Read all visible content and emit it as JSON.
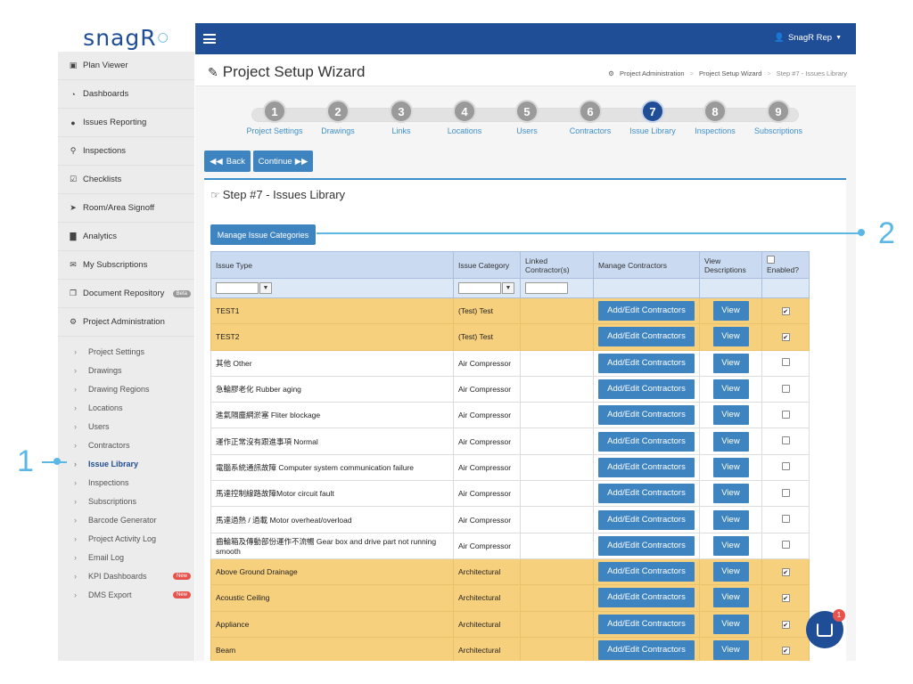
{
  "app": {
    "logo": "snagR"
  },
  "sidebar": {
    "items": [
      {
        "icon": "image-icon",
        "glyph": "▣",
        "label": "Plan Viewer"
      },
      {
        "icon": "dashboard-icon",
        "glyph": "◔",
        "label": "Dashboards"
      },
      {
        "icon": "map-pin-icon",
        "glyph": "●",
        "label": "Issues Reporting"
      },
      {
        "icon": "search-icon",
        "glyph": "⚲",
        "label": "Inspections"
      },
      {
        "icon": "checkbox-icon",
        "glyph": "☑",
        "label": "Checklists"
      },
      {
        "icon": "send-icon",
        "glyph": "➤",
        "label": "Room/Area Signoff"
      },
      {
        "icon": "bar-chart-icon",
        "glyph": "▇",
        "label": "Analytics"
      },
      {
        "icon": "envelope-icon",
        "glyph": "✉",
        "label": "My Subscriptions"
      },
      {
        "icon": "documents-icon",
        "glyph": "❐",
        "label": "Document Repository",
        "badge": "Beta"
      },
      {
        "icon": "gears-icon",
        "glyph": "⚙",
        "label": "Project Administration"
      }
    ],
    "sub_items": [
      {
        "label": "Project Settings"
      },
      {
        "label": "Drawings"
      },
      {
        "label": "Drawing Regions"
      },
      {
        "label": "Locations"
      },
      {
        "label": "Users"
      },
      {
        "label": "Contractors"
      },
      {
        "label": "Issue Library",
        "active": true
      },
      {
        "label": "Inspections"
      },
      {
        "label": "Subscriptions"
      },
      {
        "label": "Barcode Generator"
      },
      {
        "label": "Project Activity Log"
      },
      {
        "label": "Email Log"
      },
      {
        "label": "KPI Dashboards",
        "badge": "New"
      },
      {
        "label": "DMS Export",
        "badge": "New"
      }
    ]
  },
  "topbar": {
    "user": "SnagR Rep"
  },
  "page": {
    "title": "Project Setup Wizard",
    "breadcrumb": [
      "Project Administration",
      "Project Setup Wizard",
      "Step #7 - Issues Library"
    ]
  },
  "wizard": {
    "steps": [
      {
        "num": "1",
        "label": "Project Settings"
      },
      {
        "num": "2",
        "label": "Drawings"
      },
      {
        "num": "3",
        "label": "Links"
      },
      {
        "num": "4",
        "label": "Locations"
      },
      {
        "num": "5",
        "label": "Users"
      },
      {
        "num": "6",
        "label": "Contractors"
      },
      {
        "num": "7",
        "label": "Issue Library",
        "active": true
      },
      {
        "num": "8",
        "label": "Inspections"
      },
      {
        "num": "9",
        "label": "Subscriptions"
      }
    ],
    "back_label": "Back",
    "continue_label": "Continue"
  },
  "panel": {
    "title": "Step #7 - Issues Library",
    "manage_categories_label": "Manage Issue Categories"
  },
  "table": {
    "headers": {
      "issue_type": "Issue Type",
      "issue_category": "Issue Category",
      "linked_contractors": "Linked Contractor(s)",
      "manage_contractors": "Manage Contractors",
      "view_descriptions": "View Descriptions",
      "enabled": "Enabled?"
    },
    "contractor_btn": "Add/Edit Contractors",
    "view_btn": "View",
    "rows": [
      {
        "type": "TEST1",
        "category": "(Test) Test",
        "linked": "",
        "enabled": true,
        "highlight": true
      },
      {
        "type": "TEST2",
        "category": "(Test) Test",
        "linked": "",
        "enabled": true,
        "highlight": true
      },
      {
        "type": "其他 Other",
        "category": "Air Compressor",
        "linked": "",
        "enabled": false,
        "highlight": false
      },
      {
        "type": "急輪膠老化 Rubber aging",
        "category": "Air Compressor",
        "linked": "",
        "enabled": false,
        "highlight": false
      },
      {
        "type": "進氣隔塵網淤塞 Fliter blockage",
        "category": "Air Compressor",
        "linked": "",
        "enabled": false,
        "highlight": false
      },
      {
        "type": "運作正常沒有跟進事項 Normal",
        "category": "Air Compressor",
        "linked": "",
        "enabled": false,
        "highlight": false
      },
      {
        "type": "電腦系統通訊故障 Computer system communication failure",
        "category": "Air Compressor",
        "linked": "",
        "enabled": false,
        "highlight": false
      },
      {
        "type": "馬達控制線路故障Motor circuit fault",
        "category": "Air Compressor",
        "linked": "",
        "enabled": false,
        "highlight": false
      },
      {
        "type": "馬達過熱 / 過載 Motor overheat/overload",
        "category": "Air Compressor",
        "linked": "",
        "enabled": false,
        "highlight": false
      },
      {
        "type": "齒輪箱及傳動部份運作不流暢 Gear box and drive part not running smooth",
        "category": "Air Compressor",
        "linked": "",
        "enabled": false,
        "highlight": false
      },
      {
        "type": "Above Ground Drainage",
        "category": "Architectural",
        "linked": "",
        "enabled": true,
        "highlight": true
      },
      {
        "type": "Acoustic Ceiling",
        "category": "Architectural",
        "linked": "",
        "enabled": true,
        "highlight": true
      },
      {
        "type": "Appliance",
        "category": "Architectural",
        "linked": "",
        "enabled": true,
        "highlight": true
      },
      {
        "type": "Beam",
        "category": "Architectural",
        "linked": "",
        "enabled": true,
        "highlight": true
      }
    ]
  },
  "annotations": {
    "callout_1": "1",
    "callout_2": "2"
  },
  "chat": {
    "unread": "1"
  },
  "colors": {
    "brand": "#1f4e96",
    "button": "#3e84c0",
    "highlight_row": "#f7d07e",
    "callout": "#5bb8e6",
    "link": "#3e8fce"
  }
}
